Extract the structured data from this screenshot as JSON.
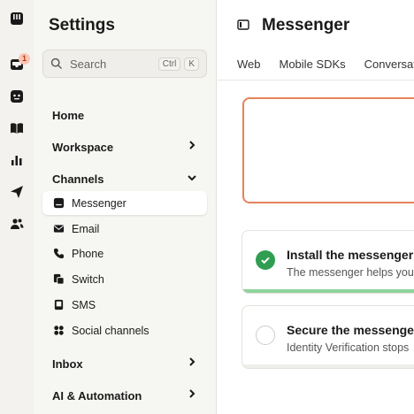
{
  "rail": {
    "items": [
      {
        "icon": "inbox-icon",
        "badge": ""
      },
      {
        "icon": "notifications-inbox-icon",
        "badge": "1"
      },
      {
        "icon": "ai-agent-icon",
        "badge": ""
      },
      {
        "icon": "knowledge-book-icon",
        "badge": ""
      },
      {
        "icon": "reports-chart-icon",
        "badge": ""
      },
      {
        "icon": "outbound-send-icon",
        "badge": ""
      },
      {
        "icon": "contacts-people-icon",
        "badge": ""
      }
    ]
  },
  "settings": {
    "title": "Settings",
    "search": {
      "placeholder": "Search",
      "shortcut_1": "Ctrl",
      "shortcut_2": "K"
    },
    "home_label": "Home",
    "workspace_label": "Workspace",
    "channels_label": "Channels",
    "channels": [
      {
        "label": "Messenger",
        "icon": "messenger-icon",
        "active": true
      },
      {
        "label": "Email",
        "icon": "email-icon",
        "active": false
      },
      {
        "label": "Phone",
        "icon": "phone-icon",
        "active": false
      },
      {
        "label": "Switch",
        "icon": "switch-icon",
        "active": false
      },
      {
        "label": "SMS",
        "icon": "sms-icon",
        "active": false
      },
      {
        "label": "Social channels",
        "icon": "social-channels-icon",
        "active": false
      }
    ],
    "inbox_label": "Inbox",
    "ai_label": "AI & Automation"
  },
  "main": {
    "title": "Messenger",
    "tabs": [
      "Web",
      "Mobile SDKs",
      "Conversations"
    ],
    "cards": [
      {
        "title": "Install the messenger",
        "description": "The messenger helps you",
        "done": true,
        "progress": 1.0
      },
      {
        "title": "Secure the messenger",
        "description": "Identity Verification stops",
        "done": false,
        "progress": 0.0
      }
    ]
  },
  "colors": {
    "accent_orange": "#e7835c",
    "success_green": "#2f9e51",
    "progress_green": "#8ed39c",
    "badge_bg": "#f9c6b6"
  }
}
